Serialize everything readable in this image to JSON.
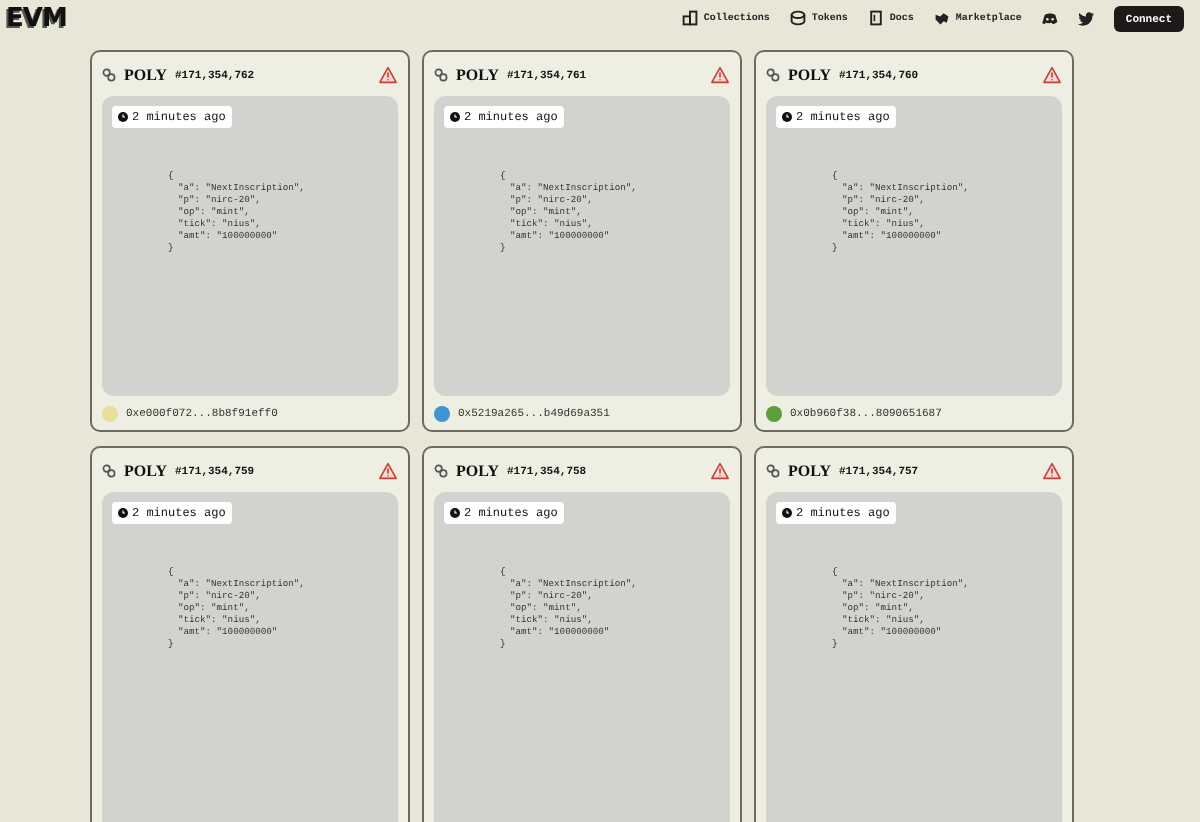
{
  "header": {
    "logo": "EVM",
    "nav": [
      {
        "kind": "collections",
        "label": "Collections"
      },
      {
        "kind": "tokens",
        "label": "Tokens"
      },
      {
        "kind": "docs",
        "label": "Docs"
      },
      {
        "kind": "marketplace",
        "label": "Marketplace"
      }
    ],
    "social": [
      {
        "kind": "discord"
      },
      {
        "kind": "twitter"
      }
    ],
    "connect": "Connect"
  },
  "cards": [
    {
      "chain": "POLY",
      "number": "#171,354,762",
      "time": "2 minutes ago",
      "body": [
        "{",
        "\"a\": \"NextInscription\",",
        "\"p\": \"nirc-20\",",
        "\"op\": \"mint\",",
        "\"tick\": \"nius\",",
        "\"amt\": \"100000000\"",
        "}"
      ],
      "owner": {
        "address": "0xe000f072...8b8f91eff0",
        "color": "#e6e09c"
      }
    },
    {
      "chain": "POLY",
      "number": "#171,354,761",
      "time": "2 minutes ago",
      "body": [
        "{",
        "\"a\": \"NextInscription\",",
        "\"p\": \"nirc-20\",",
        "\"op\": \"mint\",",
        "\"tick\": \"nius\",",
        "\"amt\": \"100000000\"",
        "}"
      ],
      "owner": {
        "address": "0x5219a265...b49d69a351",
        "color": "#3f94d4"
      }
    },
    {
      "chain": "POLY",
      "number": "#171,354,760",
      "time": "2 minutes ago",
      "body": [
        "{",
        "\"a\": \"NextInscription\",",
        "\"p\": \"nirc-20\",",
        "\"op\": \"mint\",",
        "\"tick\": \"nius\",",
        "\"amt\": \"100000000\"",
        "}"
      ],
      "owner": {
        "address": "0x0b960f38...8090651687",
        "color": "#5c9e3c"
      }
    },
    {
      "chain": "POLY",
      "number": "#171,354,759",
      "time": "2 minutes ago",
      "body": [
        "{",
        "\"a\": \"NextInscription\",",
        "\"p\": \"nirc-20\",",
        "\"op\": \"mint\",",
        "\"tick\": \"nius\",",
        "\"amt\": \"100000000\"",
        "}"
      ]
    },
    {
      "chain": "POLY",
      "number": "#171,354,758",
      "time": "2 minutes ago",
      "body": [
        "{",
        "\"a\": \"NextInscription\",",
        "\"p\": \"nirc-20\",",
        "\"op\": \"mint\",",
        "\"tick\": \"nius\",",
        "\"amt\": \"100000000\"",
        "}"
      ]
    },
    {
      "chain": "POLY",
      "number": "#171,354,757",
      "time": "2 minutes ago",
      "body": [
        "{",
        "\"a\": \"NextInscription\",",
        "\"p\": \"nirc-20\",",
        "\"op\": \"mint\",",
        "\"tick\": \"nius\",",
        "\"amt\": \"100000000\"",
        "}"
      ]
    }
  ]
}
